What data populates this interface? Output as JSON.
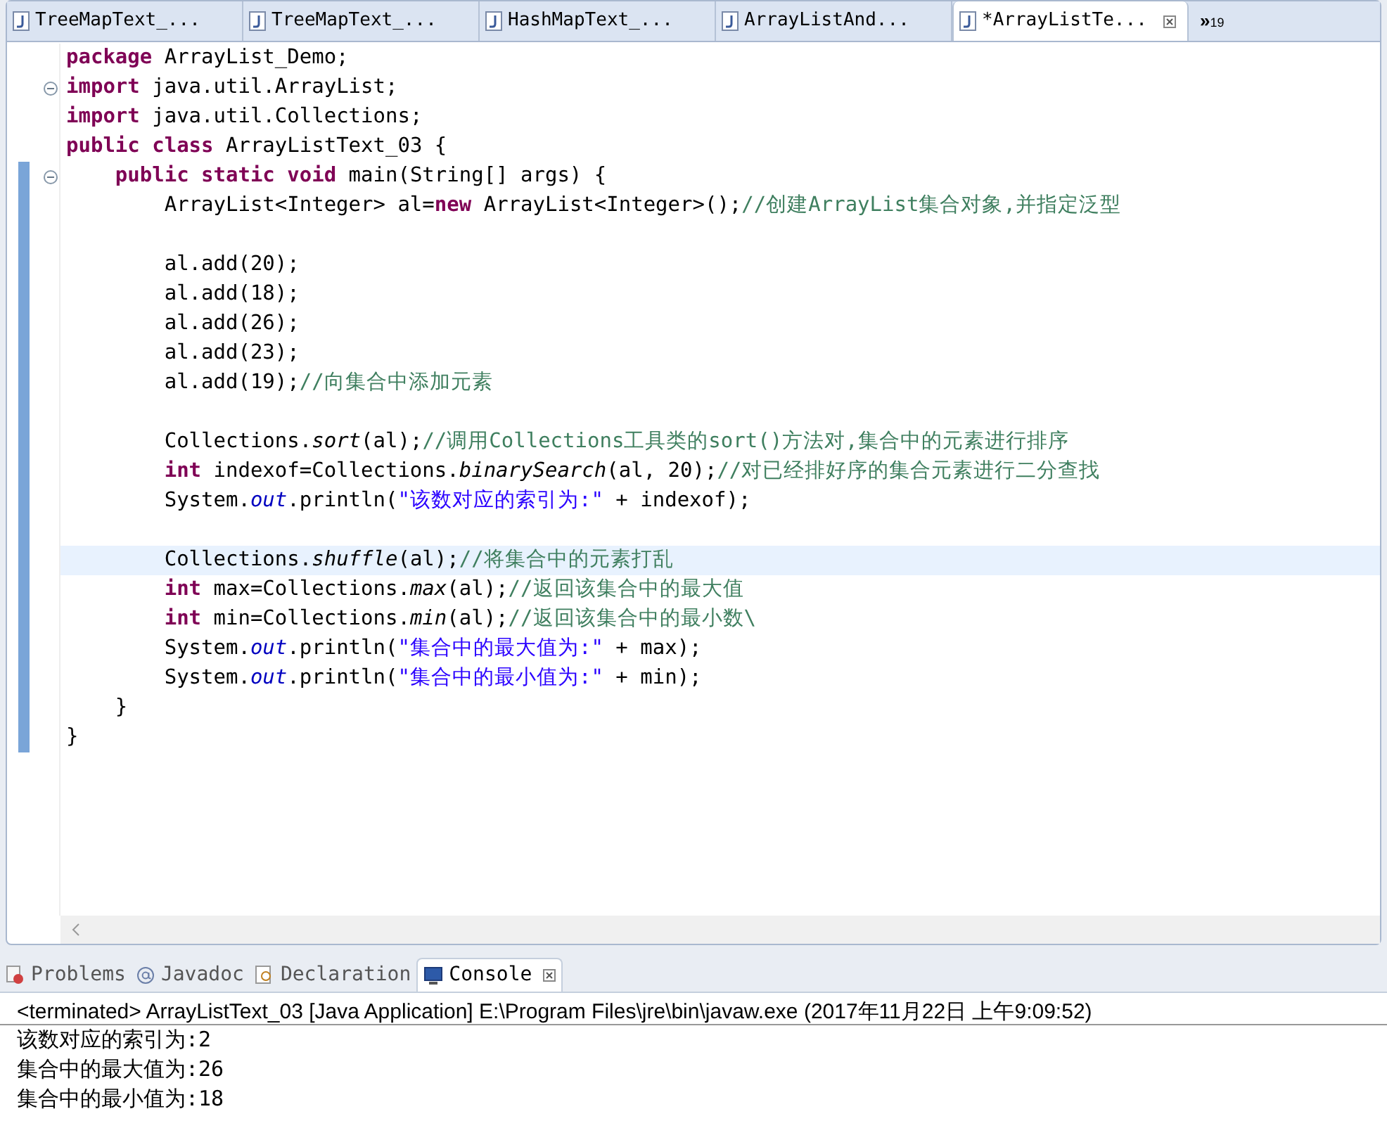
{
  "editor_tabs": [
    {
      "label": "TreeMapText_...",
      "selected": false,
      "closable": false
    },
    {
      "label": "TreeMapText_...",
      "selected": false,
      "closable": false
    },
    {
      "label": "HashMapText_...",
      "selected": false,
      "closable": false
    },
    {
      "label": "ArrayListAnd...",
      "selected": false,
      "closable": false
    },
    {
      "label": "*ArrayListTe...",
      "selected": true,
      "closable": true
    }
  ],
  "overflow": {
    "glyph": "»",
    "count": "19"
  },
  "code_lines": [
    {
      "kind": "code",
      "fold": false,
      "current": false,
      "tokens": [
        {
          "kind": "kw",
          "text": "package"
        },
        {
          "kind": "plain",
          "text": " ArrayList_Demo;"
        }
      ]
    },
    {
      "kind": "code",
      "fold": true,
      "current": false,
      "tokens": [
        {
          "kind": "kw",
          "text": "import"
        },
        {
          "kind": "plain",
          "text": " java.util.ArrayList;"
        }
      ]
    },
    {
      "kind": "code",
      "fold": false,
      "current": false,
      "tokens": [
        {
          "kind": "kw",
          "text": "import"
        },
        {
          "kind": "plain",
          "text": " java.util.Collections;"
        }
      ]
    },
    {
      "kind": "code",
      "fold": false,
      "current": false,
      "tokens": [
        {
          "kind": "kw",
          "text": "public class"
        },
        {
          "kind": "plain",
          "text": " ArrayListText_03 {"
        }
      ]
    },
    {
      "kind": "code",
      "fold": true,
      "current": false,
      "tokens": [
        {
          "kind": "kw",
          "text": "    public static void"
        },
        {
          "kind": "plain",
          "text": " main(String[] args) {"
        }
      ]
    },
    {
      "kind": "code",
      "fold": false,
      "current": false,
      "tokens": [
        {
          "kind": "plain",
          "text": "        ArrayList<Integer> al="
        },
        {
          "kind": "kw",
          "text": "new"
        },
        {
          "kind": "plain",
          "text": " ArrayList<Integer>();"
        },
        {
          "kind": "comment",
          "text": "//创建ArrayList集合对象,并指定泛型"
        }
      ]
    },
    {
      "kind": "blank"
    },
    {
      "kind": "code",
      "fold": false,
      "current": false,
      "tokens": [
        {
          "kind": "plain",
          "text": "        al.add(20);"
        }
      ]
    },
    {
      "kind": "code",
      "fold": false,
      "current": false,
      "tokens": [
        {
          "kind": "plain",
          "text": "        al.add(18);"
        }
      ]
    },
    {
      "kind": "code",
      "fold": false,
      "current": false,
      "tokens": [
        {
          "kind": "plain",
          "text": "        al.add(26);"
        }
      ]
    },
    {
      "kind": "code",
      "fold": false,
      "current": false,
      "tokens": [
        {
          "kind": "plain",
          "text": "        al.add(23);"
        }
      ]
    },
    {
      "kind": "code",
      "fold": false,
      "current": false,
      "tokens": [
        {
          "kind": "plain",
          "text": "        al.add(19);"
        },
        {
          "kind": "comment",
          "text": "//向集合中添加元素"
        }
      ]
    },
    {
      "kind": "blank"
    },
    {
      "kind": "code",
      "fold": false,
      "current": false,
      "tokens": [
        {
          "kind": "plain",
          "text": "        Collections."
        },
        {
          "kind": "method",
          "text": "sort"
        },
        {
          "kind": "plain",
          "text": "(al);"
        },
        {
          "kind": "comment",
          "text": "//调用Collections工具类的sort()方法对,集合中的元素进行排序"
        }
      ]
    },
    {
      "kind": "code",
      "fold": false,
      "current": false,
      "tokens": [
        {
          "kind": "kw",
          "text": "        int"
        },
        {
          "kind": "plain",
          "text": " indexof=Collections."
        },
        {
          "kind": "method",
          "text": "binarySearch"
        },
        {
          "kind": "plain",
          "text": "(al, 20);"
        },
        {
          "kind": "comment",
          "text": "//对已经排好序的集合元素进行二分查找"
        }
      ]
    },
    {
      "kind": "code",
      "fold": false,
      "current": false,
      "tokens": [
        {
          "kind": "plain",
          "text": "        System."
        },
        {
          "kind": "field",
          "text": "out"
        },
        {
          "kind": "plain",
          "text": ".println("
        },
        {
          "kind": "string",
          "text": "\"该数对应的索引为:\""
        },
        {
          "kind": "plain",
          "text": " + indexof);"
        }
      ]
    },
    {
      "kind": "blank"
    },
    {
      "kind": "code",
      "fold": false,
      "current": true,
      "tokens": [
        {
          "kind": "plain",
          "text": "        Collections."
        },
        {
          "kind": "method",
          "text": "shuffle"
        },
        {
          "kind": "plain",
          "text": "(al);"
        },
        {
          "kind": "comment",
          "text": "//将集合中的元素打乱"
        }
      ]
    },
    {
      "kind": "code",
      "fold": false,
      "current": false,
      "tokens": [
        {
          "kind": "kw",
          "text": "        int"
        },
        {
          "kind": "plain",
          "text": " max=Collections."
        },
        {
          "kind": "method",
          "text": "max"
        },
        {
          "kind": "plain",
          "text": "(al);"
        },
        {
          "kind": "comment",
          "text": "//返回该集合中的最大值"
        }
      ]
    },
    {
      "kind": "code",
      "fold": false,
      "current": false,
      "tokens": [
        {
          "kind": "kw",
          "text": "        int"
        },
        {
          "kind": "plain",
          "text": " min=Collections."
        },
        {
          "kind": "method",
          "text": "min"
        },
        {
          "kind": "plain",
          "text": "(al);"
        },
        {
          "kind": "comment",
          "text": "//返回该集合中的最小数\\"
        }
      ]
    },
    {
      "kind": "code",
      "fold": false,
      "current": false,
      "tokens": [
        {
          "kind": "plain",
          "text": "        System."
        },
        {
          "kind": "field",
          "text": "out"
        },
        {
          "kind": "plain",
          "text": ".println("
        },
        {
          "kind": "string",
          "text": "\"集合中的最大值为:\""
        },
        {
          "kind": "plain",
          "text": " + max);"
        }
      ]
    },
    {
      "kind": "code",
      "fold": false,
      "current": false,
      "tokens": [
        {
          "kind": "plain",
          "text": "        System."
        },
        {
          "kind": "field",
          "text": "out"
        },
        {
          "kind": "plain",
          "text": ".println("
        },
        {
          "kind": "string",
          "text": "\"集合中的最小值为:\""
        },
        {
          "kind": "plain",
          "text": " + min);"
        }
      ]
    },
    {
      "kind": "code",
      "fold": false,
      "current": false,
      "tokens": [
        {
          "kind": "plain",
          "text": "    }"
        }
      ]
    },
    {
      "kind": "code",
      "fold": false,
      "current": false,
      "tokens": [
        {
          "kind": "plain",
          "text": "}"
        }
      ]
    }
  ],
  "bottom_tabs": [
    {
      "kind": "problems",
      "label": "Problems",
      "selected": false,
      "closable": false
    },
    {
      "kind": "javadoc",
      "label": "Javadoc",
      "selected": false,
      "closable": false
    },
    {
      "kind": "declaration",
      "label": "Declaration",
      "selected": false,
      "closable": false
    },
    {
      "kind": "console",
      "label": "Console",
      "selected": true,
      "closable": true
    }
  ],
  "console": {
    "header": "<terminated> ArrayListText_03 [Java Application] E:\\Program Files\\jre\\bin\\javaw.exe (2017年11月22日 上午9:09:52)",
    "output": [
      "该数对应的索引为:2",
      "集合中的最大值为:26",
      "集合中的最小值为:18"
    ]
  }
}
